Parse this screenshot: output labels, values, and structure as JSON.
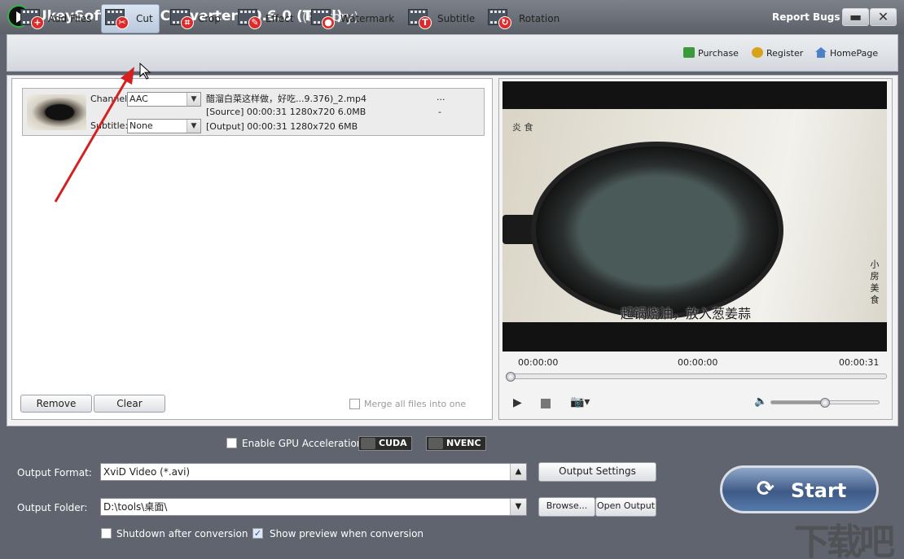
{
  "window": {
    "title": "UkeySoft Video Converter 10.6.0 (Trial)",
    "subtitle": "(History)",
    "report_bugs": "Report Bugs",
    "minimize_glyph": "▬",
    "close_glyph": "✕"
  },
  "toolbar": {
    "items": [
      {
        "label": "Add Files",
        "icon": "add-icon",
        "glyph": "+"
      },
      {
        "label": "Cut",
        "icon": "scissors-icon",
        "glyph": "✂"
      },
      {
        "label": "Crop",
        "icon": "crop-icon",
        "glyph": "⌗"
      },
      {
        "label": "Effect",
        "icon": "magic-wand-icon",
        "glyph": "✎"
      },
      {
        "label": "Watermark",
        "icon": "droplet-icon",
        "glyph": "●"
      },
      {
        "label": "Subtitle",
        "icon": "text-icon",
        "glyph": "T"
      },
      {
        "label": "Rotation",
        "icon": "rotate-icon",
        "glyph": "↻"
      }
    ],
    "links": [
      {
        "label": "Purchase",
        "icon": "cart-icon"
      },
      {
        "label": "Register",
        "icon": "award-icon"
      },
      {
        "label": "HomePage",
        "icon": "home-icon"
      }
    ]
  },
  "file": {
    "channel_label": "Channel:",
    "channel_value": "AAC",
    "subtitle_label": "Subtitle:",
    "subtitle_value": "None",
    "name": "醋溜白菜这样做，好吃...9.376)_2.mp4",
    "source": "[Source]  00:00:31  1280x720  6.0MB",
    "output": "[Output]  00:00:31  1280x720  6MB",
    "more": "...",
    "dash": "-"
  },
  "list_controls": {
    "remove": "Remove",
    "clear": "Clear",
    "merge": "Merge all files into one"
  },
  "preview": {
    "caption": "起锅烧油，放入葱姜蒜",
    "logo_top": "炎 食",
    "logo_side": "小 房 美 食",
    "time_start": "00:00:00",
    "time_mid": "00:00:00",
    "time_end": "00:00:31",
    "seek_fraction": 0.0,
    "volume_fraction": 0.5
  },
  "gpu": {
    "label": "Enable GPU Acceleration",
    "cuda": "CUDA",
    "nvenc": "NVENC"
  },
  "output": {
    "format_label": "Output Format:",
    "format_value": "XviD Video (*.avi)",
    "settings_button": "Output Settings",
    "folder_label": "Output Folder:",
    "folder_value": "D:\\tools\\桌面\\",
    "browse_button": "Browse...",
    "open_button": "Open Output"
  },
  "options": {
    "shutdown": "Shutdown after conversion",
    "shutdown_checked": false,
    "show_preview": "Show preview when conversion",
    "show_preview_checked": true
  },
  "start_button": "Start",
  "watermark_text": "下载吧"
}
